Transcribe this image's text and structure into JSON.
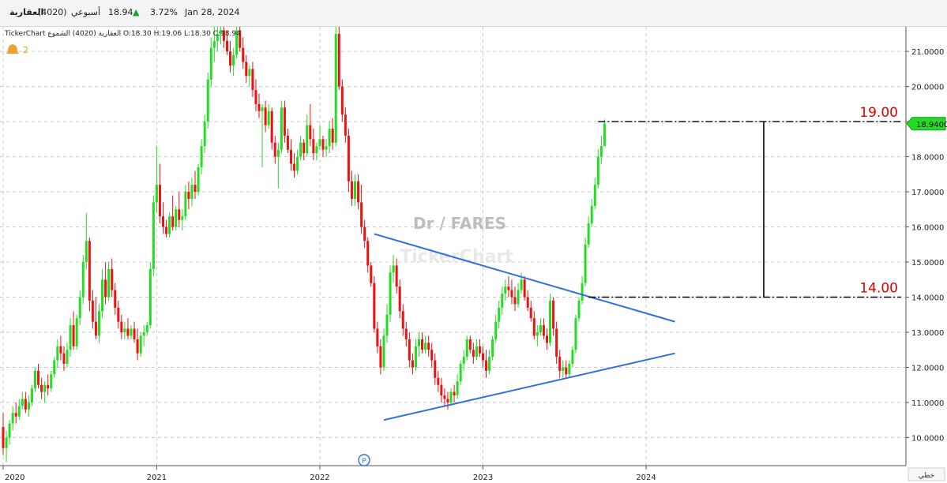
{
  "header": {
    "symbol_name": "العقارية",
    "symbol_code": "(4020)",
    "period": "أسبوعي",
    "price": "18.94",
    "change_pct": "3.72%",
    "date": "Jan 28, 2024",
    "colors": {
      "up": "#18a12b",
      "down": "#e01b1b"
    }
  },
  "info_line": "TickerChart العقارية (4020) الشموع   O:18.30   H:19.06   L:18.30   C:18.94",
  "alerts": {
    "icon": "bell-icon",
    "count": "2"
  },
  "watermarks": {
    "author": "Dr / FARES",
    "brand": "TickerChart"
  },
  "markers": {
    "p_label": "P"
  },
  "price_tag": "18.9400",
  "level_labels": {
    "top": "19.00",
    "bottom": "14.00"
  },
  "bottom_right_label": "خطي",
  "chart_data": {
    "type": "candlestick",
    "title": "",
    "x_ticks": [
      "2020",
      "2021",
      "2022",
      "2023",
      "2024"
    ],
    "y_ticks": [
      "10.0000",
      "11.0000",
      "12.0000",
      "13.0000",
      "14.0000",
      "15.0000",
      "16.0000",
      "17.0000",
      "18.0000",
      "19.0000",
      "20.0000",
      "21.0000"
    ],
    "ylim": [
      9.2,
      21.7
    ],
    "colors": {
      "up": "#22dd22",
      "down": "#ee1111",
      "trendline": "#2f6fe0",
      "level": "#000000",
      "level_label": "#dd0000"
    },
    "ohlc": [
      [
        10.3,
        10.7,
        9.5,
        9.7
      ],
      [
        9.7,
        10.2,
        9.3,
        10.0
      ],
      [
        10.0,
        10.5,
        9.8,
        10.4
      ],
      [
        10.4,
        10.9,
        10.2,
        10.7
      ],
      [
        10.7,
        11.0,
        10.4,
        10.6
      ],
      [
        10.6,
        11.1,
        10.5,
        10.9
      ],
      [
        10.9,
        11.3,
        10.8,
        11.1
      ],
      [
        11.1,
        11.3,
        10.7,
        10.8
      ],
      [
        10.8,
        11.2,
        10.6,
        11.0
      ],
      [
        11.0,
        11.5,
        10.9,
        11.4
      ],
      [
        11.4,
        12.0,
        11.3,
        11.9
      ],
      [
        11.9,
        12.1,
        11.4,
        11.5
      ],
      [
        11.5,
        11.7,
        11.1,
        11.3
      ],
      [
        11.3,
        11.6,
        11.0,
        11.5
      ],
      [
        11.5,
        11.8,
        11.2,
        11.4
      ],
      [
        11.4,
        11.9,
        11.3,
        11.8
      ],
      [
        11.8,
        12.3,
        11.7,
        12.2
      ],
      [
        12.2,
        12.8,
        12.0,
        12.6
      ],
      [
        12.6,
        12.9,
        12.2,
        12.4
      ],
      [
        12.4,
        12.6,
        11.9,
        12.1
      ],
      [
        12.1,
        12.7,
        12.0,
        12.5
      ],
      [
        12.5,
        13.4,
        12.3,
        13.2
      ],
      [
        13.2,
        13.6,
        12.5,
        12.6
      ],
      [
        12.6,
        13.5,
        12.5,
        13.4
      ],
      [
        13.4,
        14.2,
        13.2,
        14.0
      ],
      [
        14.0,
        15.2,
        13.8,
        15.0
      ],
      [
        15.0,
        16.4,
        14.8,
        15.6
      ],
      [
        15.6,
        15.7,
        13.6,
        13.9
      ],
      [
        13.9,
        14.2,
        13.1,
        13.3
      ],
      [
        13.3,
        14.0,
        12.8,
        12.9
      ],
      [
        12.9,
        13.8,
        12.7,
        13.6
      ],
      [
        13.6,
        14.8,
        13.4,
        14.5
      ],
      [
        14.5,
        15.0,
        13.8,
        14.0
      ],
      [
        14.0,
        15.0,
        13.9,
        14.8
      ],
      [
        14.8,
        15.1,
        14.0,
        14.2
      ],
      [
        14.2,
        14.4,
        13.5,
        13.7
      ],
      [
        13.7,
        13.9,
        13.1,
        13.3
      ],
      [
        13.3,
        13.5,
        12.8,
        13.0
      ],
      [
        13.0,
        13.3,
        12.8,
        13.1
      ],
      [
        13.1,
        13.4,
        12.8,
        12.9
      ],
      [
        12.9,
        13.2,
        12.8,
        13.1
      ],
      [
        13.1,
        13.3,
        12.7,
        12.8
      ],
      [
        12.8,
        13.1,
        12.2,
        12.4
      ],
      [
        12.4,
        13.0,
        12.3,
        12.9
      ],
      [
        12.9,
        13.2,
        12.6,
        13.0
      ],
      [
        13.0,
        13.3,
        12.9,
        13.2
      ],
      [
        13.2,
        15.0,
        13.1,
        14.8
      ],
      [
        14.8,
        16.9,
        14.6,
        16.7
      ],
      [
        16.7,
        18.3,
        16.4,
        17.2
      ],
      [
        17.2,
        17.8,
        16.1,
        16.3
      ],
      [
        16.3,
        16.7,
        15.8,
        16.0
      ],
      [
        16.0,
        16.2,
        15.7,
        15.8
      ],
      [
        15.8,
        16.4,
        15.7,
        16.3
      ],
      [
        16.3,
        16.9,
        15.9,
        16.0
      ],
      [
        16.0,
        16.6,
        15.9,
        16.5
      ],
      [
        16.5,
        17.0,
        16.0,
        16.2
      ],
      [
        16.2,
        16.5,
        15.9,
        16.3
      ],
      [
        16.3,
        17.2,
        16.2,
        17.0
      ],
      [
        17.0,
        17.3,
        16.5,
        16.8
      ],
      [
        16.8,
        17.4,
        16.6,
        17.2
      ],
      [
        17.2,
        17.6,
        16.8,
        17.0
      ],
      [
        17.0,
        17.8,
        16.9,
        17.7
      ],
      [
        17.7,
        18.5,
        17.5,
        18.3
      ],
      [
        18.3,
        19.2,
        18.1,
        19.0
      ],
      [
        19.0,
        20.4,
        18.8,
        20.2
      ],
      [
        20.2,
        21.4,
        20.0,
        21.1
      ],
      [
        21.1,
        21.7,
        20.7,
        21.3
      ],
      [
        21.3,
        21.7,
        21.0,
        21.5
      ],
      [
        21.5,
        21.7,
        21.2,
        21.6
      ],
      [
        21.6,
        21.7,
        21.1,
        21.3
      ],
      [
        21.3,
        21.6,
        20.9,
        21.0
      ],
      [
        21.0,
        21.3,
        20.4,
        20.6
      ],
      [
        20.6,
        21.1,
        20.3,
        20.9
      ],
      [
        20.9,
        21.7,
        20.8,
        21.6
      ],
      [
        21.6,
        21.7,
        21.0,
        21.1
      ],
      [
        21.1,
        21.4,
        20.5,
        20.7
      ],
      [
        20.7,
        20.9,
        20.1,
        20.3
      ],
      [
        20.3,
        20.6,
        20.0,
        20.5
      ],
      [
        20.5,
        20.7,
        19.7,
        19.9
      ],
      [
        19.9,
        20.2,
        19.3,
        19.5
      ],
      [
        19.5,
        19.8,
        19.1,
        19.3
      ],
      [
        19.3,
        19.5,
        17.7,
        19.4
      ],
      [
        19.4,
        19.6,
        18.7,
        18.9
      ],
      [
        18.9,
        19.5,
        18.8,
        19.3
      ],
      [
        19.3,
        19.4,
        18.2,
        18.4
      ],
      [
        18.4,
        18.6,
        17.8,
        18.0
      ],
      [
        18.0,
        18.4,
        17.1,
        18.2
      ],
      [
        18.2,
        19.6,
        18.1,
        19.4
      ],
      [
        19.4,
        19.6,
        18.4,
        18.6
      ],
      [
        18.6,
        18.8,
        18.1,
        18.2
      ],
      [
        18.2,
        18.5,
        17.6,
        17.8
      ],
      [
        17.8,
        18.1,
        17.4,
        17.6
      ],
      [
        17.6,
        18.2,
        17.5,
        18.0
      ],
      [
        18.0,
        18.6,
        17.9,
        18.4
      ],
      [
        18.4,
        18.5,
        17.9,
        18.1
      ],
      [
        18.1,
        19.2,
        18.0,
        18.9
      ],
      [
        18.9,
        19.5,
        18.3,
        18.5
      ],
      [
        18.5,
        18.8,
        17.9,
        18.1
      ],
      [
        18.1,
        18.4,
        17.9,
        18.3
      ],
      [
        18.3,
        18.9,
        18.2,
        18.5
      ],
      [
        18.5,
        18.6,
        18.0,
        18.2
      ],
      [
        18.2,
        18.5,
        18.0,
        18.3
      ],
      [
        18.3,
        19.0,
        18.1,
        18.8
      ],
      [
        18.8,
        19.1,
        18.2,
        18.4
      ],
      [
        18.4,
        21.7,
        18.3,
        21.5
      ],
      [
        21.5,
        21.7,
        19.9,
        20.0
      ],
      [
        20.0,
        20.2,
        19.0,
        19.2
      ],
      [
        19.2,
        19.4,
        18.4,
        18.6
      ],
      [
        18.6,
        18.8,
        17.0,
        17.3
      ],
      [
        17.3,
        17.6,
        16.6,
        16.8
      ],
      [
        16.8,
        17.5,
        16.6,
        17.3
      ],
      [
        17.3,
        17.5,
        16.5,
        16.7
      ],
      [
        16.7,
        17.2,
        15.8,
        16.0
      ],
      [
        16.0,
        16.2,
        15.4,
        15.6
      ],
      [
        15.6,
        15.7,
        14.7,
        14.9
      ],
      [
        14.9,
        15.0,
        14.3,
        14.4
      ],
      [
        14.4,
        14.6,
        13.0,
        13.1
      ],
      [
        13.1,
        13.3,
        12.4,
        12.6
      ],
      [
        12.6,
        12.8,
        11.8,
        12.0
      ],
      [
        12.0,
        13.1,
        11.9,
        12.9
      ],
      [
        12.9,
        13.8,
        12.7,
        13.5
      ],
      [
        13.5,
        14.9,
        13.3,
        14.7
      ],
      [
        14.7,
        15.2,
        14.4,
        14.9
      ],
      [
        14.9,
        15.1,
        14.1,
        14.3
      ],
      [
        14.3,
        14.5,
        13.4,
        13.6
      ],
      [
        13.6,
        13.8,
        12.9,
        13.1
      ],
      [
        13.1,
        13.3,
        12.6,
        12.8
      ],
      [
        12.8,
        13.0,
        12.0,
        12.2
      ],
      [
        12.2,
        12.4,
        11.8,
        12.0
      ],
      [
        12.0,
        12.8,
        11.9,
        12.6
      ],
      [
        12.6,
        13.0,
        12.3,
        12.8
      ],
      [
        12.8,
        13.0,
        12.4,
        12.5
      ],
      [
        12.5,
        12.9,
        12.4,
        12.7
      ],
      [
        12.7,
        12.9,
        12.3,
        12.5
      ],
      [
        12.5,
        12.7,
        12.0,
        12.2
      ],
      [
        12.2,
        12.4,
        11.5,
        11.7
      ],
      [
        11.7,
        11.9,
        11.3,
        11.5
      ],
      [
        11.5,
        11.7,
        11.0,
        11.2
      ],
      [
        11.2,
        11.4,
        10.9,
        11.1
      ],
      [
        11.1,
        11.3,
        10.8,
        11.0
      ],
      [
        11.0,
        11.4,
        10.9,
        11.3
      ],
      [
        11.3,
        11.5,
        11.0,
        11.2
      ],
      [
        11.2,
        11.8,
        11.1,
        11.6
      ],
      [
        11.6,
        12.2,
        11.5,
        12.1
      ],
      [
        12.1,
        12.5,
        11.9,
        12.3
      ],
      [
        12.3,
        12.9,
        12.2,
        12.8
      ],
      [
        12.8,
        12.9,
        12.4,
        12.5
      ],
      [
        12.5,
        12.7,
        12.1,
        12.3
      ],
      [
        12.3,
        12.8,
        12.2,
        12.6
      ],
      [
        12.6,
        12.8,
        12.3,
        12.4
      ],
      [
        12.4,
        12.6,
        12.0,
        12.2
      ],
      [
        12.2,
        12.5,
        11.7,
        11.9
      ],
      [
        11.9,
        12.5,
        11.8,
        12.3
      ],
      [
        12.3,
        12.9,
        12.2,
        12.8
      ],
      [
        12.8,
        13.5,
        12.7,
        13.3
      ],
      [
        13.3,
        13.9,
        13.1,
        13.7
      ],
      [
        13.7,
        14.3,
        13.5,
        14.1
      ],
      [
        14.1,
        14.5,
        13.9,
        14.3
      ],
      [
        14.3,
        14.6,
        14.0,
        14.2
      ],
      [
        14.2,
        14.5,
        13.8,
        14.0
      ],
      [
        14.0,
        14.3,
        13.6,
        13.8
      ],
      [
        13.8,
        14.4,
        13.7,
        14.2
      ],
      [
        14.2,
        14.7,
        14.1,
        14.5
      ],
      [
        14.5,
        14.6,
        13.9,
        14.0
      ],
      [
        14.0,
        14.2,
        13.6,
        13.7
      ],
      [
        13.7,
        13.9,
        13.3,
        13.4
      ],
      [
        13.4,
        13.6,
        12.8,
        12.9
      ],
      [
        12.9,
        13.2,
        12.6,
        13.0
      ],
      [
        13.0,
        13.4,
        12.9,
        13.2
      ],
      [
        13.2,
        13.4,
        12.8,
        12.9
      ],
      [
        12.9,
        13.1,
        12.5,
        12.7
      ],
      [
        12.7,
        14.1,
        12.6,
        13.9
      ],
      [
        13.9,
        14.0,
        12.9,
        13.1
      ],
      [
        13.1,
        13.3,
        12.1,
        12.3
      ],
      [
        12.3,
        12.5,
        11.7,
        11.9
      ],
      [
        11.9,
        12.2,
        11.7,
        12.0
      ],
      [
        12.0,
        12.2,
        11.7,
        11.8
      ],
      [
        11.8,
        12.2,
        11.7,
        12.1
      ],
      [
        12.1,
        12.6,
        12.0,
        12.5
      ],
      [
        12.5,
        13.5,
        12.4,
        13.4
      ],
      [
        13.4,
        14.0,
        13.3,
        13.9
      ],
      [
        13.9,
        14.6,
        13.8,
        14.4
      ],
      [
        14.4,
        15.7,
        14.3,
        15.5
      ],
      [
        15.5,
        16.3,
        15.4,
        16.1
      ],
      [
        16.1,
        16.8,
        16.0,
        16.6
      ],
      [
        16.6,
        17.4,
        16.5,
        17.2
      ],
      [
        17.2,
        18.2,
        17.1,
        18.0
      ],
      [
        18.0,
        18.6,
        17.8,
        18.3
      ],
      [
        18.3,
        19.06,
        18.3,
        18.94
      ]
    ],
    "x_tick_bars": [
      0,
      48,
      99,
      150,
      201
    ],
    "trendlines": [
      {
        "name": "upper",
        "from": [
          116,
          15.8
        ],
        "to": [
          210,
          13.3
        ]
      },
      {
        "name": "lower",
        "from": [
          119,
          10.5
        ],
        "to": [
          210,
          12.4
        ]
      }
    ],
    "levels": [
      {
        "name": "19.00",
        "value": 19.0,
        "from_bar": 186,
        "label": "top"
      },
      {
        "name": "14.00",
        "value": 14.0,
        "from_bar": 183,
        "label": "bottom"
      }
    ]
  }
}
